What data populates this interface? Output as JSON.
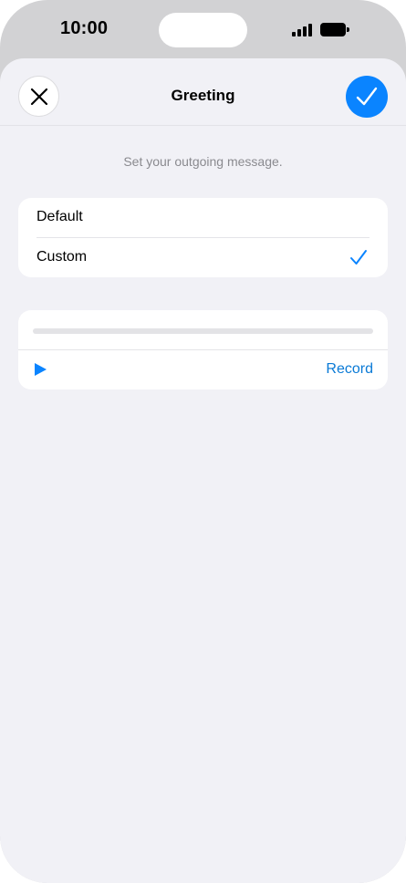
{
  "status_bar": {
    "time": "10:00"
  },
  "nav": {
    "title": "Greeting",
    "close_icon": "close-icon",
    "done_icon": "checkmark-icon"
  },
  "hint": "Set your outgoing message.",
  "options": [
    {
      "label": "Default",
      "selected": false
    },
    {
      "label": "Custom",
      "selected": true
    }
  ],
  "player": {
    "progress": 0,
    "play_icon": "play-icon",
    "record_label": "Record"
  },
  "colors": {
    "accent": "#0a84ff",
    "link": "#0a7ad6",
    "background": "#f1f1f6",
    "frame": "#d2d2d4"
  }
}
